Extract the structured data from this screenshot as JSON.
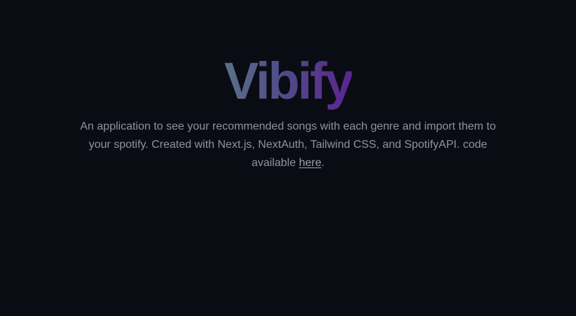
{
  "app": {
    "logo_text": "Vibify"
  },
  "hero": {
    "description_text": "An application to see your recommended songs with each genre and import them to your spotify. Created with Next.js, NextAuth, Tailwind CSS, and SpotifyAPI. code available ",
    "link_label": "here",
    "trailing_text": "."
  },
  "colors": {
    "background": "#0a0c13",
    "logo_gradient_start": "#5a7088",
    "logo_gradient_end": "#5a2590",
    "body_text": "#8e939f"
  }
}
